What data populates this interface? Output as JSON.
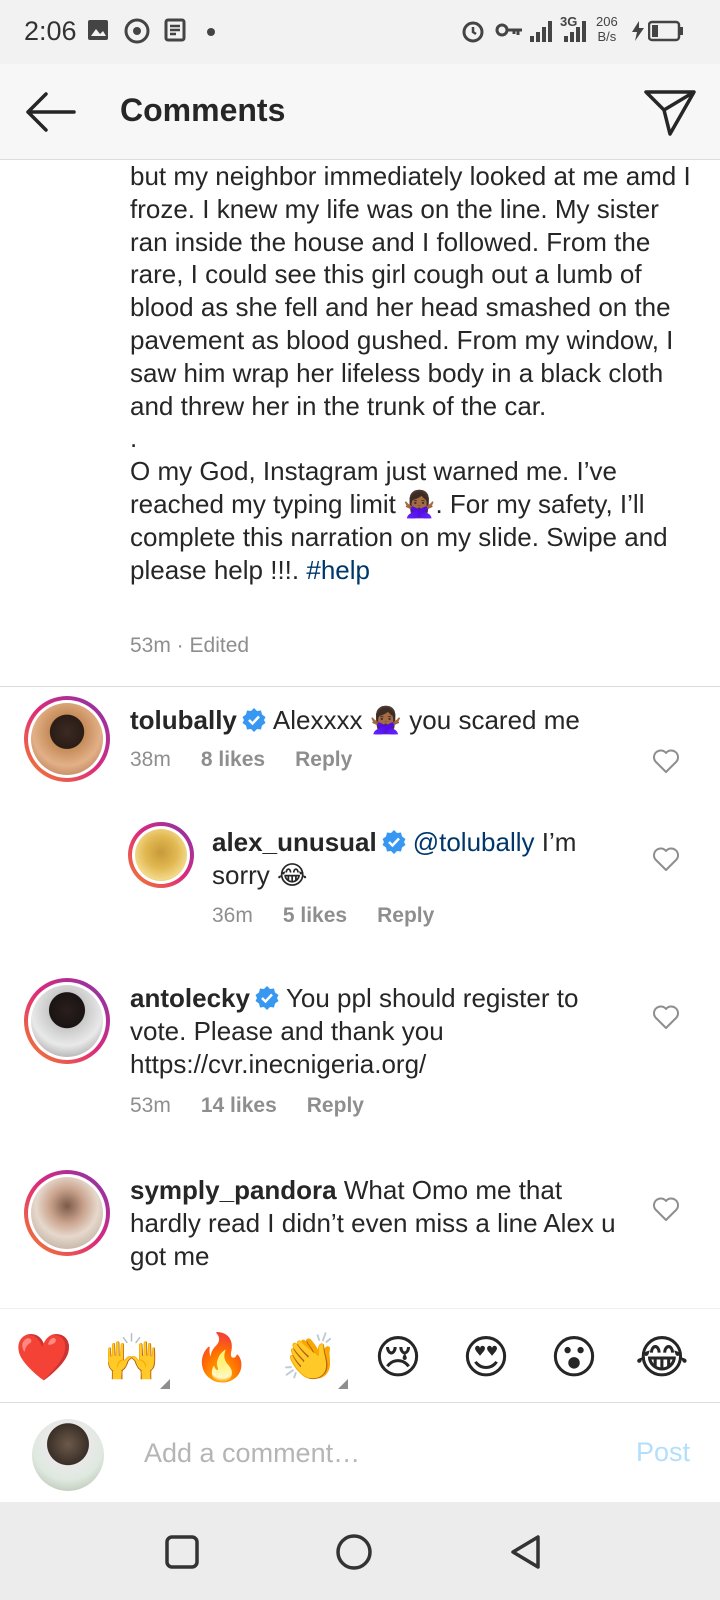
{
  "status_bar": {
    "time": "2:06",
    "network_speed_value": "206",
    "network_speed_unit": "B/s",
    "network_type": "3G"
  },
  "header": {
    "title": "Comments"
  },
  "caption": {
    "paragraphs": [
      "but my neighbor immediately looked at me amd I froze. I knew my life was on the line. My sister ran inside the house and I followed. From the rare, I could see this girl cough out a lumb of blood as she fell and her head smashed on the pavement as blood gushed. From my window, I saw him wrap her lifeless body in a black cloth and threw her in the trunk of the car.",
      ".",
      "O my God, Instagram just warned me. I’ve reached my typing limit 🙅🏾‍♀️. For my safety, I’ll complete this narration on my slide. Swipe and please help !!!."
    ],
    "hashtag": "#help",
    "meta": "53m · Edited"
  },
  "comments": [
    {
      "username": "tolubally",
      "text": "Alexxxx 🙅🏾‍♀️ you scared me",
      "time": "38m",
      "likes": "8 likes",
      "reply": "Reply"
    },
    {
      "username": "alex_unusual",
      "mention": "@tolubally",
      "text": "I’m sorry 😂",
      "time": "36m",
      "likes": "5 likes",
      "reply": "Reply"
    },
    {
      "username": "antolecky",
      "text": "You ppl should register to vote. Please and thank you https://cvr.inecnigeria.org/",
      "time": "53m",
      "likes": "14 likes",
      "reply": "Reply"
    },
    {
      "username": "symply_pandora",
      "text": "What Omo  me that hardly read I didn’t even miss a line Alex u got me"
    }
  ],
  "emoji_bar": [
    "❤️",
    "🙌",
    "🔥",
    "👏",
    "😢",
    "😍",
    "😮",
    "😂"
  ],
  "comment_bar": {
    "placeholder": "Add a comment…",
    "post_label": "Post"
  },
  "colors": {
    "link": "#00376b",
    "meta_gray": "#8e8e8e",
    "post_disabled": "#b2dffc",
    "verified_blue": "#3897f0"
  },
  "icons": [
    "back-arrow-icon",
    "direct-share-icon",
    "verified-badge-icon",
    "heart-outline-icon",
    "square-nav-icon",
    "circle-nav-icon",
    "triangle-back-nav-icon"
  ]
}
